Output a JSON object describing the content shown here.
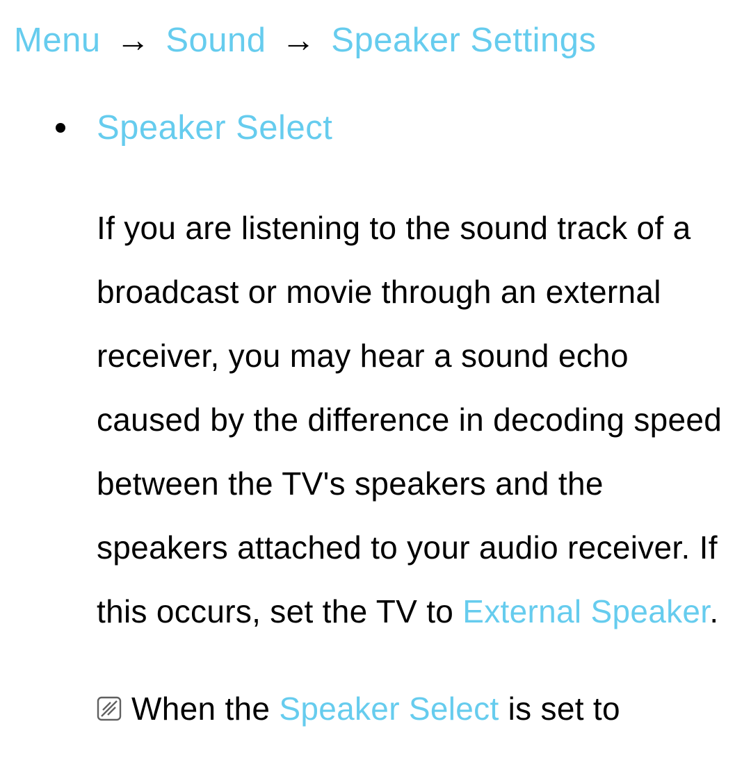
{
  "breadcrumb": {
    "item1": "Menu",
    "item2": "Sound",
    "item3": "Speaker Settings",
    "arrow": "→"
  },
  "section": {
    "title": "Speaker Select"
  },
  "body": {
    "part1": "If you are listening to the sound track of a broadcast or movie through an external receiver, you may hear a sound echo caused by the difference in decoding speed between the TV's speakers and the speakers attached to your audio receiver. If this occurs, set the TV to ",
    "highlight1": "External Speaker",
    "part2": "."
  },
  "note": {
    "part1": "When the ",
    "highlight1": "Speaker Select",
    "part2": " is set to"
  }
}
